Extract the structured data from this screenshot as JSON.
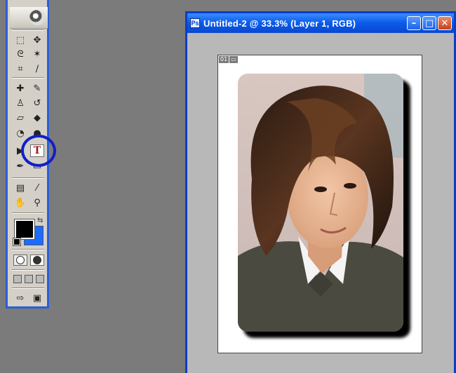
{
  "toolbox": {
    "tools": [
      {
        "name": "marquee-tool-icon",
        "glyph": "⬚"
      },
      {
        "name": "move-tool-icon",
        "glyph": "✥"
      },
      {
        "name": "lasso-tool-icon",
        "glyph": "ᘓ"
      },
      {
        "name": "magic-wand-tool-icon",
        "glyph": "✶"
      },
      {
        "name": "crop-tool-icon",
        "glyph": "⌗"
      },
      {
        "name": "slice-tool-icon",
        "glyph": "∕"
      },
      {
        "name": "healing-brush-tool-icon",
        "glyph": "✚"
      },
      {
        "name": "brush-tool-icon",
        "glyph": "✎"
      },
      {
        "name": "clone-stamp-tool-icon",
        "glyph": "♙"
      },
      {
        "name": "history-brush-tool-icon",
        "glyph": "↺"
      },
      {
        "name": "eraser-tool-icon",
        "glyph": "▱"
      },
      {
        "name": "paint-bucket-tool-icon",
        "glyph": "◆"
      },
      {
        "name": "blur-tool-icon",
        "glyph": "◔"
      },
      {
        "name": "dodge-tool-icon",
        "glyph": "●"
      },
      {
        "name": "path-selection-tool-icon",
        "glyph": "▶"
      },
      {
        "name": "type-tool-icon",
        "glyph": "T"
      },
      {
        "name": "pen-tool-icon",
        "glyph": "✒"
      },
      {
        "name": "shape-tool-icon",
        "glyph": "▭"
      },
      {
        "name": "notes-tool-icon",
        "glyph": "▤"
      },
      {
        "name": "eyedropper-tool-icon",
        "glyph": "⁄"
      },
      {
        "name": "hand-tool-icon",
        "glyph": "✋"
      },
      {
        "name": "zoom-tool-icon",
        "glyph": "⚲"
      }
    ],
    "foreground_color": "#000000",
    "background_color": "#1b6cff",
    "highlight_color": "#1020c8"
  },
  "document": {
    "title": "Untitled-2 @ 33.3% (Layer 1, RGB)",
    "minimize_label": "–",
    "maximize_label": "□",
    "close_label": "✕",
    "slice_number": "01"
  },
  "colors": {
    "window_frame": "#0a3ec8",
    "desktop": "#7b7b7b",
    "canvas_bg": "#b8b8b8"
  }
}
